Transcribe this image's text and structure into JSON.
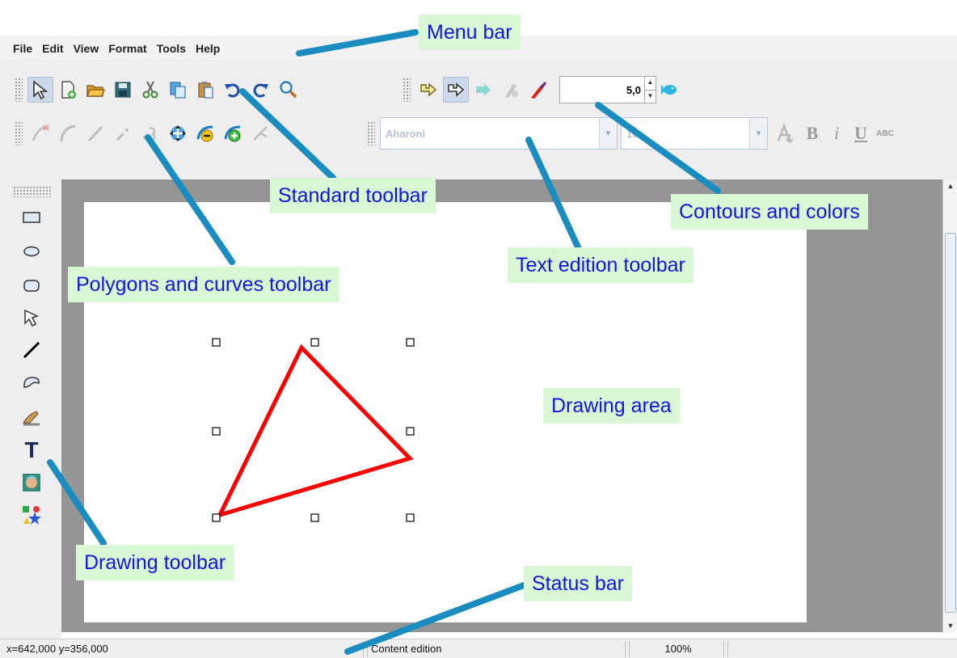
{
  "menu": [
    "File",
    "Edit",
    "View",
    "Format",
    "Tools",
    "Help"
  ],
  "standard_toolbar": {
    "icons": [
      "select-arrow-icon",
      "new-document-icon",
      "open-folder-icon",
      "save-floppy-icon",
      "cut-scissors-icon",
      "copy-icon",
      "paste-icon",
      "undo-icon",
      "redo-icon",
      "zoom-magnifier-icon"
    ]
  },
  "contours_toolbar": {
    "icons": [
      "contour-arrow-icon",
      "contour-outline-icon",
      "fill-arrow-icon",
      "shadow-icon",
      "color-brush-icon",
      "fish-color-icon"
    ],
    "stroke_width": "5,0"
  },
  "polygons_toolbar": {
    "icons": [
      "add-point-icon",
      "curve-icon",
      "line-tool-icon",
      "pencil-icon",
      "curve-point-icon",
      "move-points-icon",
      "remove-point-icon",
      "add-point-green-icon",
      "split-icon"
    ]
  },
  "text_toolbar": {
    "font": "Aharoni",
    "size": "10",
    "format_labels": {
      "bold": "B",
      "italic": "i",
      "underline": "U",
      "caps": "ABC"
    }
  },
  "drawing_toolbar": {
    "icons": [
      "rectangle-icon",
      "ellipse-icon",
      "rounded-rect-icon",
      "polygon-icon",
      "line-icon",
      "freehand-closed-icon",
      "hand-edit-icon",
      "text-tool-icon",
      "image-icon",
      "shapes-star-icon"
    ],
    "text_tool_glyph": "T"
  },
  "canvas": {
    "shape": "triangle",
    "stroke_color": "#ff0000"
  },
  "status": {
    "coords": "x=642,000 y=356,000",
    "mode": "Content edition",
    "zoom": "100%"
  },
  "callouts": {
    "menu_bar": "Menu bar",
    "standard_toolbar": "Standard toolbar",
    "contours_colors": "Contours and colors",
    "polygons_curves": "Polygons and curves toolbar",
    "text_edition": "Text edition toolbar",
    "drawing_area": "Drawing area",
    "drawing_toolbar": "Drawing toolbar",
    "status_bar": "Status bar"
  },
  "colors": {
    "callout_bg": "#d9f7d4",
    "callout_text": "#1515e0",
    "leader_line": "#1a8cc0",
    "canvas_gray": "#959595"
  }
}
